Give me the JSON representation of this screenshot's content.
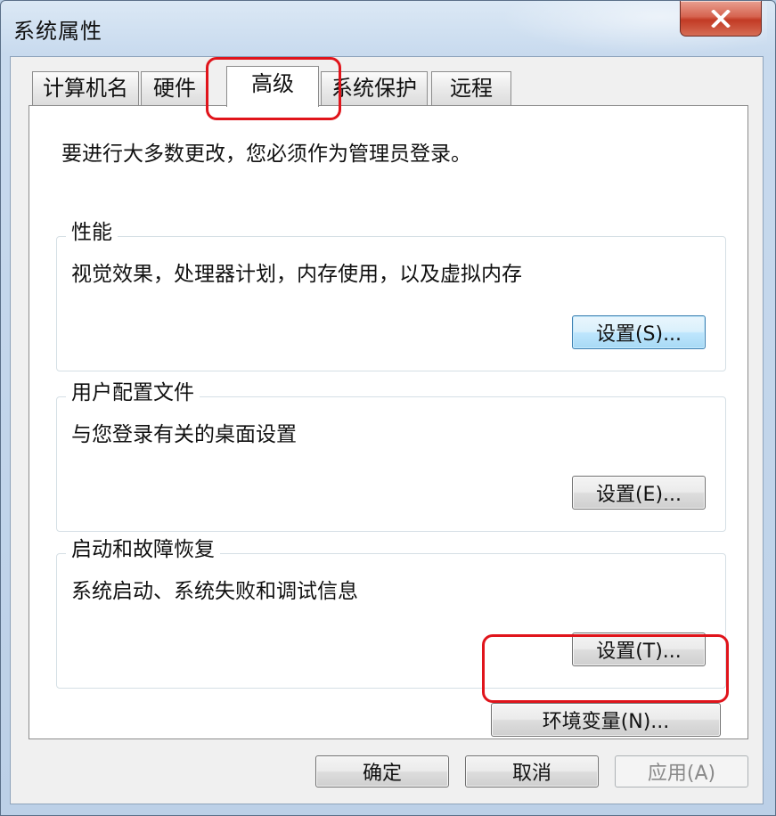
{
  "window": {
    "title": "系统属性"
  },
  "tabs": [
    {
      "label": "计算机名"
    },
    {
      "label": "硬件"
    },
    {
      "label": "高级"
    },
    {
      "label": "系统保护"
    },
    {
      "label": "远程"
    }
  ],
  "advanced": {
    "admin_note": "要进行大多数更改，您必须作为管理员登录。",
    "performance": {
      "title": "性能",
      "description": "视觉效果，处理器计划，内存使用，以及虚拟内存",
      "button": "设置(S)..."
    },
    "user_profiles": {
      "title": "用户配置文件",
      "description": "与您登录有关的桌面设置",
      "button": "设置(E)..."
    },
    "startup_recovery": {
      "title": "启动和故障恢复",
      "description": "系统启动、系统失败和调试信息",
      "button": "设置(T)..."
    },
    "env_vars_button": "环境变量(N)..."
  },
  "footer": {
    "ok": "确定",
    "cancel": "取消",
    "apply": "应用(A)"
  },
  "colors": {
    "highlight_border": "#e0141b",
    "focused_button": "#bee6fd",
    "close_button": "#c23a24"
  }
}
